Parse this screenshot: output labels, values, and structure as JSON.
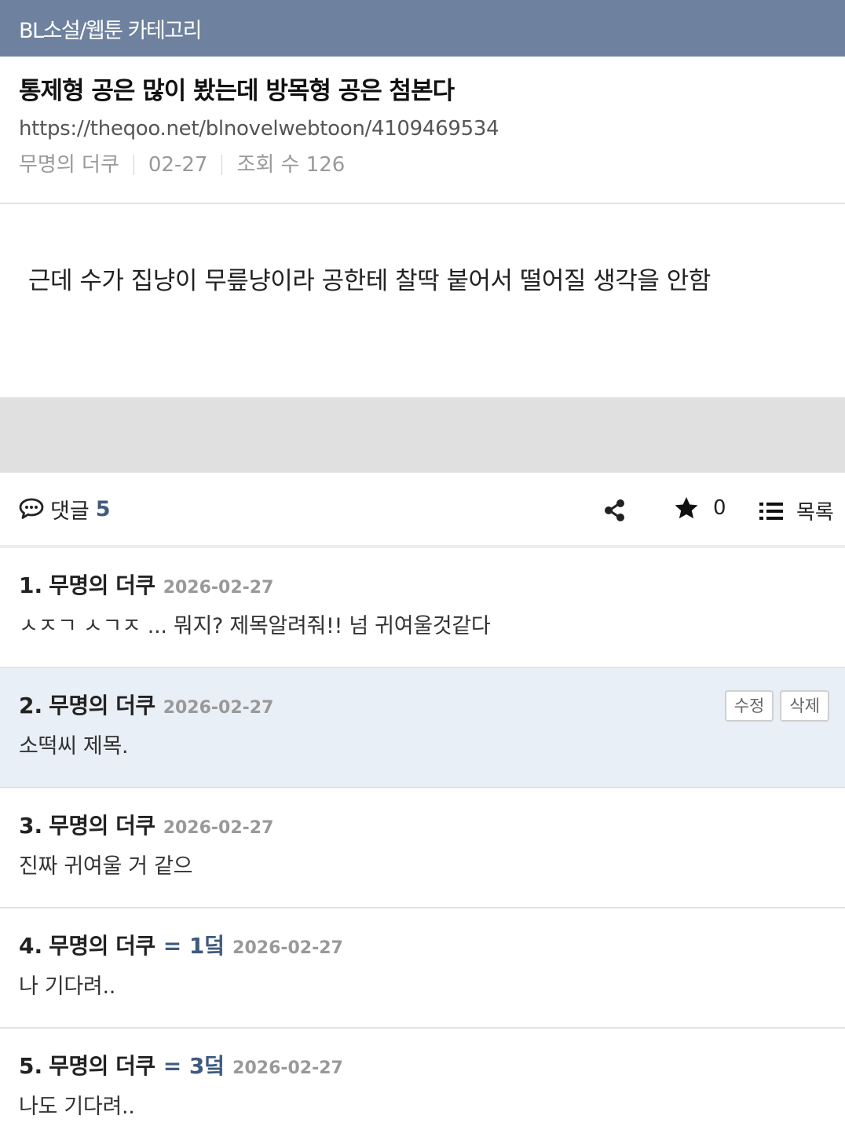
{
  "topbar": {
    "title": "BL소설/웹툰 카테고리"
  },
  "post": {
    "title": "통제형 공은 많이 봤는데 방목형 공은 첨본다",
    "url": "https://theqoo.net/blnovelwebtoon/4109469534",
    "author": "무명의 더쿠",
    "date": "02-27",
    "views_label": "조회 수 126",
    "content": "근데 수가 집냥이 무릎냥이라 공한테 찰딱 붙어서 떨어질 생각을 안함"
  },
  "actions": {
    "comments_label": "댓글",
    "comments_count": "5",
    "comment_icon": "speech-bubble-icon",
    "share_icon": "share-icon",
    "star_icon": "star-icon",
    "star_count": "0",
    "list_icon": "list-icon",
    "list_label": "목록"
  },
  "comments": [
    {
      "num": "1.",
      "author": "무명의 더쿠",
      "level": "",
      "date": "2026-02-27",
      "body": "ㅅㅈㄱ ㅅㄱㅈ ... 뭐지? 제목알려줘!! 넘 귀여울것같다"
    },
    {
      "num": "2.",
      "author": "무명의 더쿠",
      "level": "",
      "date": "2026-02-27",
      "body": "소떡씨 제목.",
      "edit_label": "수정",
      "delete_label": "삭제"
    },
    {
      "num": "3.",
      "author": "무명의 더쿠",
      "level": "",
      "date": "2026-02-27",
      "body": "진짜 귀여울 거 같으"
    },
    {
      "num": "4.",
      "author": "무명의 더쿠",
      "level": "= 1덬",
      "date": "2026-02-27",
      "body": "나 기다려.."
    },
    {
      "num": "5.",
      "author": "무명의 더쿠",
      "level": "= 3덬",
      "date": "2026-02-27",
      "body": "나도 기다려.."
    }
  ],
  "colors": {
    "topbar": "#6e819e",
    "accent": "#3f5a7e",
    "highlight_row": "#e9eff6",
    "band": "#e0e0e0"
  }
}
